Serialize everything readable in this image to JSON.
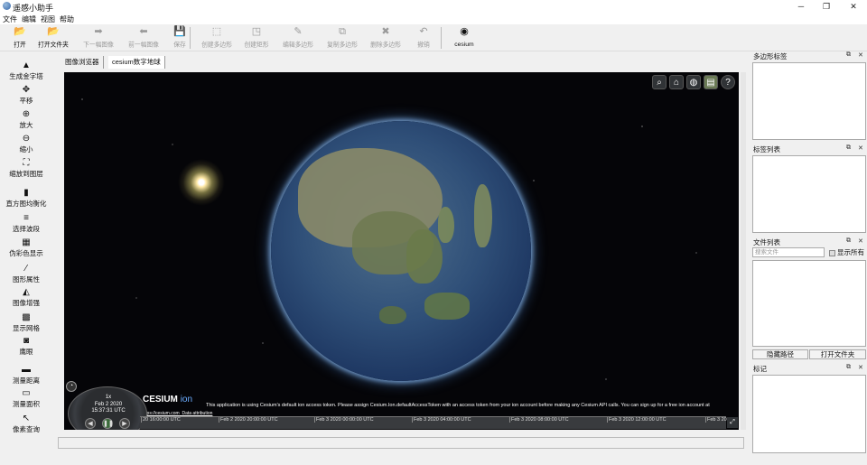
{
  "window": {
    "title": "遥感小助手",
    "minimize": "─",
    "maximize": "❐",
    "close": "✕"
  },
  "menu": [
    "文件",
    "编辑",
    "视图",
    "帮助"
  ],
  "toolbar": [
    {
      "label": "打开",
      "icon": "open-icon",
      "glyph": "📂",
      "enabled": true
    },
    {
      "label": "打开文件夹",
      "icon": "open-folder-icon",
      "glyph": "📂",
      "enabled": true
    },
    {
      "label": "下一幅图像",
      "icon": "arrow-right-icon",
      "glyph": "➡",
      "enabled": false
    },
    {
      "label": "前一幅图像",
      "icon": "arrow-left-icon",
      "glyph": "⬅",
      "enabled": false
    },
    {
      "label": "保存",
      "icon": "save-icon",
      "glyph": "💾",
      "enabled": false
    },
    {
      "label": "创建多边形",
      "icon": "polygon-icon",
      "glyph": "⬚",
      "enabled": false
    },
    {
      "label": "创建矩形",
      "icon": "rectangle-icon",
      "glyph": "◳",
      "enabled": false
    },
    {
      "label": "编辑多边形",
      "icon": "edit-polygon-icon",
      "glyph": "✎",
      "enabled": false
    },
    {
      "label": "复制多边形",
      "icon": "copy-polygon-icon",
      "glyph": "⧉",
      "enabled": false
    },
    {
      "label": "删除多边形",
      "icon": "delete-polygon-icon",
      "glyph": "✖",
      "enabled": false
    },
    {
      "label": "撤销",
      "icon": "undo-icon",
      "glyph": "↶",
      "enabled": false
    },
    {
      "label": "cesium",
      "icon": "cesium-icon",
      "glyph": "◉",
      "enabled": true
    }
  ],
  "left_tools": [
    {
      "label": "生成金字塔",
      "icon": "pyramid-icon",
      "glyph": "▲"
    },
    {
      "label": "平移",
      "icon": "pan-icon",
      "glyph": "✥"
    },
    {
      "label": "放大",
      "icon": "zoom-in-icon",
      "glyph": "⊕"
    },
    {
      "label": "缩小",
      "icon": "zoom-out-icon",
      "glyph": "⊖"
    },
    {
      "label": "缩放到图层",
      "icon": "zoom-layer-icon",
      "glyph": "⛶"
    },
    {
      "label": "直方图均衡化",
      "icon": "histogram-icon",
      "glyph": "▮"
    },
    {
      "label": "选择波段",
      "icon": "band-icon",
      "glyph": "≡"
    },
    {
      "label": "伪彩色显示",
      "icon": "pseudocolor-icon",
      "glyph": "▦"
    },
    {
      "label": "图形属性",
      "icon": "properties-icon",
      "glyph": "⁄"
    },
    {
      "label": "图像增强",
      "icon": "enhance-icon",
      "glyph": "◭"
    },
    {
      "label": "显示网格",
      "icon": "grid-icon",
      "glyph": "▩"
    },
    {
      "label": "鹰眼",
      "icon": "eagle-eye-icon",
      "glyph": "◙"
    },
    {
      "label": "测量距离",
      "icon": "measure-distance-icon",
      "glyph": "▬"
    },
    {
      "label": "测量面积",
      "icon": "measure-area-icon",
      "glyph": "▭"
    },
    {
      "label": "像素查询",
      "icon": "pixel-query-icon",
      "glyph": "↖"
    }
  ],
  "tabs": [
    "图像浏览器",
    "cesium数字地球"
  ],
  "viewer": {
    "buttons": [
      {
        "icon": "search-icon",
        "glyph": "⌕"
      },
      {
        "icon": "home-icon",
        "glyph": "⌂"
      },
      {
        "icon": "globe-mode-icon",
        "glyph": "◍"
      },
      {
        "icon": "layers-icon",
        "glyph": "▤"
      },
      {
        "icon": "help-icon",
        "glyph": "?"
      }
    ],
    "ion_logo": "CESIUM",
    "ion_suffix": "ion",
    "credit": "This application is using Cesium's default ion access token. Please assign Cesium.Ion.defaultAccessToken with an access token from your ion account before making any Cesium API calls. You can sign up for a free ion account at",
    "credit_link": "https://cesium.com",
    "data_attribution": "Data attribution",
    "animation": {
      "speed": "1x",
      "date": "Feb 2 2020",
      "time": "15:37:31 UTC"
    },
    "timeline_ticks": [
      "20 16:00:00 UTC",
      "Feb 2 2020 20:00:00 UTC",
      "Feb 3 2020 00:00:00 UTC",
      "Feb 3 2020 04:00:00 UTC",
      "Feb 3 2020 08:00:00 UTC",
      "Feb 3 2020 12:00:00 UTC",
      "Feb 3 20"
    ]
  },
  "panels": {
    "polygon_labels": {
      "title": "多边形标签"
    },
    "label_list": {
      "title": "标签列表"
    },
    "file_list": {
      "title": "文件列表",
      "search_placeholder": "搜索文件",
      "show_all": "显示所有"
    },
    "path_buttons": {
      "hide": "隐藏路径",
      "open": "打开文件夹"
    },
    "marks": {
      "title": "标记"
    },
    "float_glyph": "⧉",
    "close_glyph": "✕"
  }
}
